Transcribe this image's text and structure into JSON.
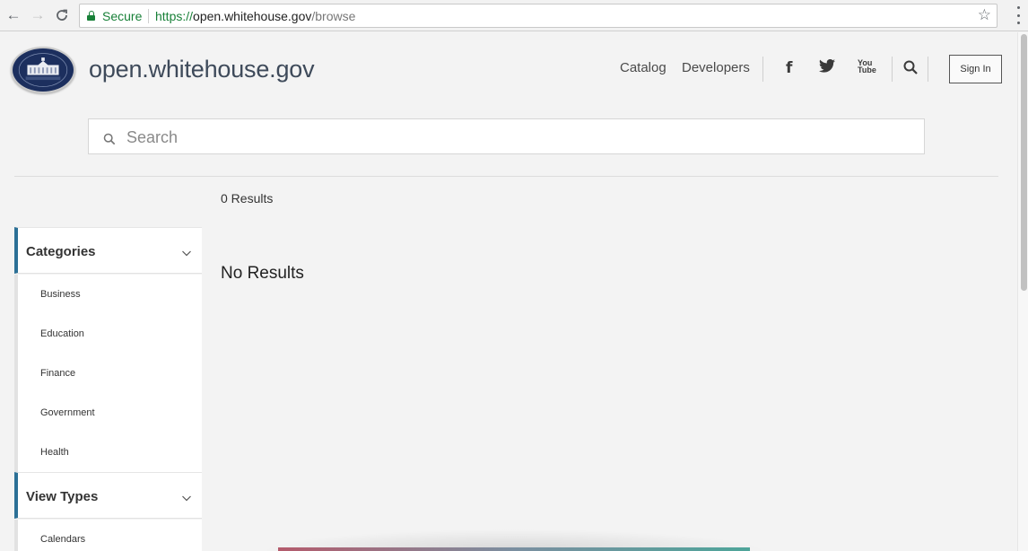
{
  "browser": {
    "secure_label": "Secure",
    "url_scheme": "https://",
    "url_host": "open.whitehouse.gov",
    "url_path": "/browse"
  },
  "header": {
    "site_title": "open.whitehouse.gov",
    "nav": {
      "catalog": "Catalog",
      "developers": "Developers"
    },
    "social": {
      "facebook": "f",
      "youtube_line1": "You",
      "youtube_line2": "Tube"
    },
    "sign_in": "Sign In"
  },
  "search": {
    "placeholder": "Search"
  },
  "results": {
    "count_text": "0 Results",
    "empty_text": "No Results"
  },
  "sidebar": {
    "categories": {
      "title": "Categories",
      "items": [
        "Business",
        "Education",
        "Finance",
        "Government",
        "Health"
      ]
    },
    "view_types": {
      "title": "View Types",
      "items": [
        "Calendars"
      ]
    }
  },
  "colors": {
    "accent": "#2c7096",
    "secure_green": "#188038"
  },
  "icons": [
    "back-arrow-icon",
    "forward-arrow-icon",
    "reload-icon",
    "lock-icon",
    "star-icon",
    "menu-icon",
    "facebook-icon",
    "twitter-icon",
    "youtube-icon",
    "search-icon",
    "chevron-down-icon"
  ]
}
